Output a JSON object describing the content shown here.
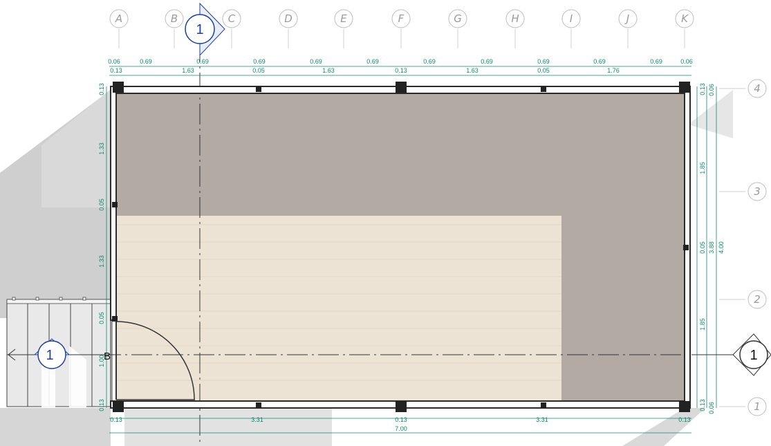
{
  "grid_columns": [
    "A",
    "B",
    "C",
    "D",
    "E",
    "F",
    "G",
    "H",
    "I",
    "J",
    "K"
  ],
  "grid_rows": [
    "4",
    "3",
    "2",
    "1"
  ],
  "top_dims_row1": [
    "0.06",
    "0.69",
    "0.69",
    "0.69",
    "0.69",
    "0.69",
    "0.69",
    "0.69",
    "0.69",
    "0.69",
    "0.69",
    "0.06"
  ],
  "top_dims_row2": [
    "0.13",
    "1.63",
    "0.05",
    "1.63",
    "0.13",
    "1.63",
    "0.05",
    "1.76"
  ],
  "left_dims": [
    "0.13",
    "1.33",
    "0.05",
    "1.33",
    "0.05",
    "1.00",
    "0.13"
  ],
  "right_dims_inner": [
    "0.13",
    "1.85",
    "0.05",
    "1.85",
    "0.13"
  ],
  "right_dims_mid": [
    "0.06",
    "3.88",
    "0.06"
  ],
  "right_dims_outer": "4.00",
  "bottom_dims_row1": [
    "0.13",
    "3.31",
    "0.13",
    "3.31",
    "0.13"
  ],
  "bottom_dims_total": "7.00",
  "section_markers": {
    "top": "1",
    "left": "1",
    "right": "1",
    "left_letter": "B"
  },
  "colors": {
    "dark_floor": "#b3aaa3",
    "light_floor": "#ede3d5",
    "dim_green": "#0b8a6e",
    "section_blue": "#1d3f9c",
    "wall": "#2a2a2a"
  }
}
